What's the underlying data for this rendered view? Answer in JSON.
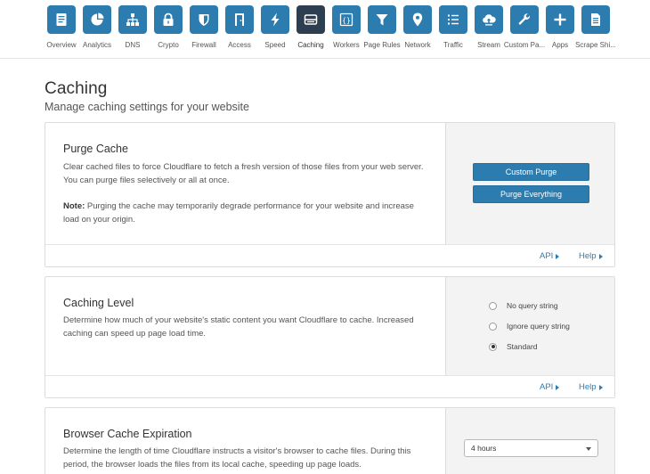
{
  "nav": {
    "items": [
      {
        "label": "Overview",
        "icon": "overview-icon"
      },
      {
        "label": "Analytics",
        "icon": "analytics-icon"
      },
      {
        "label": "DNS",
        "icon": "dns-icon"
      },
      {
        "label": "Crypto",
        "icon": "lock-icon"
      },
      {
        "label": "Firewall",
        "icon": "shield-icon"
      },
      {
        "label": "Access",
        "icon": "door-icon"
      },
      {
        "label": "Speed",
        "icon": "lightning-icon"
      },
      {
        "label": "Caching",
        "icon": "server-icon",
        "active": true
      },
      {
        "label": "Workers",
        "icon": "code-braces-icon"
      },
      {
        "label": "Page Rules",
        "icon": "filter-icon"
      },
      {
        "label": "Network",
        "icon": "location-pin-icon"
      },
      {
        "label": "Traffic",
        "icon": "list-icon"
      },
      {
        "label": "Stream",
        "icon": "cloud-upload-icon"
      },
      {
        "label": "Custom Pa...",
        "icon": "wrench-icon"
      },
      {
        "label": "Apps",
        "icon": "plus-icon"
      },
      {
        "label": "Scrape Shi...",
        "icon": "document-icon"
      }
    ],
    "icon_color": "#2c7cb0",
    "active_icon_color": "#2d3e50"
  },
  "page": {
    "title": "Caching",
    "subtitle": "Manage caching settings for your website"
  },
  "purge": {
    "title": "Purge Cache",
    "description": "Clear cached files to force Cloudflare to fetch a fresh version of those files from your web server. You can purge files selectively or all at once.",
    "note_label": "Note:",
    "note_text": " Purging the cache may temporarily degrade performance for your website and increase load on your origin.",
    "custom_purge_label": "Custom Purge",
    "purge_everything_label": "Purge Everything",
    "api_label": "API",
    "help_label": "Help"
  },
  "caching_level": {
    "title": "Caching Level",
    "description": "Determine how much of your website's static content you want Cloudflare to cache. Increased caching can speed up page load time.",
    "options": [
      {
        "label": "No query string",
        "checked": false
      },
      {
        "label": "Ignore query string",
        "checked": false
      },
      {
        "label": "Standard",
        "checked": true
      }
    ],
    "api_label": "API",
    "help_label": "Help"
  },
  "browser_cache": {
    "title": "Browser Cache Expiration",
    "description": "Determine the length of time Cloudflare instructs a visitor's browser to cache files. During this period, the browser loads the files from its local cache, speeding up page loads.",
    "selected_value": "4 hours"
  }
}
